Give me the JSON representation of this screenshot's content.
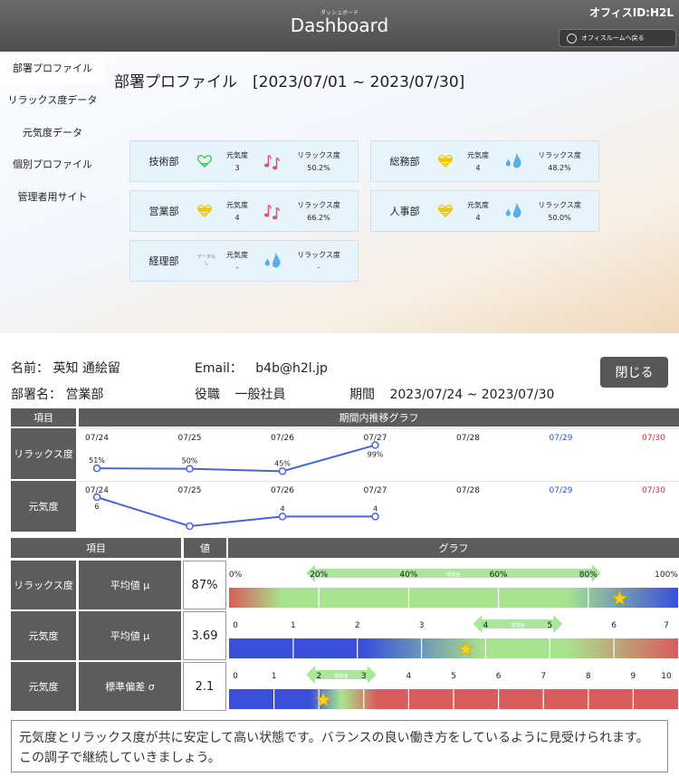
{
  "header": {
    "title": "Dashboard",
    "subtitle": "ダッシュボード",
    "office_id": "オフィスID:H2L",
    "back_button": "オフィスルームへ戻る"
  },
  "sidebar": {
    "items": [
      {
        "label": "部署プロファイル",
        "active": true
      },
      {
        "label": "リラックス度データ",
        "active": false
      },
      {
        "label": "元気度データ",
        "active": false
      },
      {
        "label": "個別プロファイル",
        "active": false
      },
      {
        "label": "管理者用サイト",
        "active": false
      }
    ]
  },
  "department_profile": {
    "heading": "部署プロファイル　[2023/07/01 ~ 2023/07/30]",
    "genki_label": "元気度",
    "relax_label": "リラックス度",
    "no_data": "データなし",
    "departments": [
      {
        "name": "技術部",
        "genki": "3",
        "relax": "50.2%",
        "heart_level": 0.3,
        "heart_color": "#3cc04a",
        "relax_icon": "music-notes-icon"
      },
      {
        "name": "総務部",
        "genki": "4",
        "relax": "48.2%",
        "heart_level": 0.7,
        "heart_color": "#f0c800",
        "relax_icon": "water-drops-icon"
      },
      {
        "name": "営業部",
        "genki": "4",
        "relax": "66.2%",
        "heart_level": 0.7,
        "heart_color": "#f0c800",
        "relax_icon": "music-notes-icon"
      },
      {
        "name": "人事部",
        "genki": "4",
        "relax": "50.0%",
        "heart_level": 0.7,
        "heart_color": "#f0c800",
        "relax_icon": "water-drops-icon"
      },
      {
        "name": "経理部",
        "genki": "-",
        "relax": "-",
        "heart_level": 0,
        "heart_color": "",
        "relax_icon": "water-drops-icon"
      }
    ]
  },
  "employee": {
    "name_label": "名前：",
    "name": "英知 通絵留",
    "email_label": "Email：",
    "email": "b4b@h2l.jp",
    "dept_label": "部署名：",
    "dept": "営業部",
    "role_label": "役職",
    "role": "一般社員",
    "period_label": "期間",
    "period": "2023/07/24 ~ 2023/07/30",
    "close_button": "閉じる"
  },
  "trend": {
    "col_item": "項目",
    "col_graph": "期間内推移グラフ",
    "dates": [
      "07/24",
      "07/25",
      "07/26",
      "07/27",
      "07/28",
      "07/29",
      "07/30"
    ],
    "date_colors": [
      "#222",
      "#222",
      "#222",
      "#222",
      "#222",
      "#2b4fd6",
      "#d62b2b"
    ],
    "relax": {
      "label": "リラックス度",
      "values": [
        51,
        50,
        45,
        99
      ],
      "value_labels": [
        "51%",
        "50%",
        "45%",
        "99%"
      ]
    },
    "genki": {
      "label": "元気度",
      "values": [
        6,
        3,
        4,
        4
      ],
      "value_labels": [
        "6",
        "3",
        "4",
        "4"
      ]
    }
  },
  "stats": {
    "col_item": "項目",
    "col_value": "値",
    "col_graph": "グラフ",
    "target_label": "理想値",
    "rows": [
      {
        "item": "リラックス度",
        "metric": "平均値 μ",
        "value": "87%",
        "axis_min": 0,
        "axis_max": 100,
        "tick_labels": [
          "0%",
          "20%",
          "40%",
          "60%",
          "80%",
          "100%"
        ],
        "tick_values": [
          0,
          20,
          40,
          60,
          80,
          100
        ],
        "target_range": [
          20,
          80
        ],
        "marker": 87,
        "scale_colors": [
          "#d95c5c",
          "#a8e48f",
          "#a8e48f",
          "#3a4fd9"
        ],
        "scale_stops": [
          0,
          12,
          75,
          100
        ]
      },
      {
        "item": "元気度",
        "metric": "平均値 μ",
        "value": "3.69",
        "axis_min": 0,
        "axis_max": 7,
        "tick_labels": [
          "0",
          "1",
          "2",
          "3",
          "4",
          "5",
          "6",
          "7"
        ],
        "tick_values": [
          0,
          1,
          2,
          3,
          4,
          5,
          6,
          7
        ],
        "target_range": [
          4,
          5
        ],
        "marker": 3.69,
        "scale_colors": [
          "#3a4fd9",
          "#3a4fd9",
          "#a8e48f",
          "#a8e48f",
          "#d95c5c"
        ],
        "scale_stops": [
          0,
          30,
          57,
          75,
          100
        ]
      },
      {
        "item": "元気度",
        "metric": "標準偏差 σ",
        "value": "2.1",
        "axis_min": 0,
        "axis_max": 10,
        "tick_labels": [
          "0",
          "1",
          "2",
          "3",
          "4",
          "5",
          "6",
          "7",
          "8",
          "9",
          "10"
        ],
        "tick_values": [
          0,
          1,
          2,
          3,
          4,
          5,
          6,
          7,
          8,
          9,
          10
        ],
        "target_range": [
          2,
          3
        ],
        "marker": 2.1,
        "scale_colors": [
          "#3a4fd9",
          "#3a4fd9",
          "#a8e48f",
          "#d95c5c",
          "#d95c5c"
        ],
        "scale_stops": [
          0,
          18,
          25,
          33,
          100
        ]
      }
    ]
  },
  "message": "元気度とリラックス度が共に安定して高い状態です。バランスの良い働き方をしているように見受けられます。この調子で継続していきましょう。"
}
